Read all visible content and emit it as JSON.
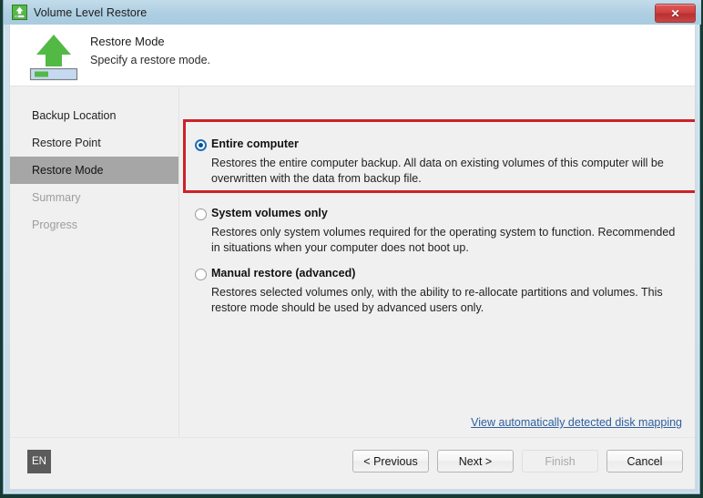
{
  "window": {
    "title": "Volume Level Restore",
    "icon": "restore-drive-icon",
    "close_label": "✕"
  },
  "header": {
    "title": "Restore Mode",
    "subtitle": "Specify a restore mode.",
    "icon": "green-up-arrow-drive-icon"
  },
  "sidebar": {
    "items": [
      {
        "label": "Backup Location",
        "state": "normal"
      },
      {
        "label": "Restore Point",
        "state": "normal"
      },
      {
        "label": "Restore Mode",
        "state": "active"
      },
      {
        "label": "Summary",
        "state": "disabled"
      },
      {
        "label": "Progress",
        "state": "disabled"
      }
    ]
  },
  "main": {
    "options": [
      {
        "label": "Entire computer",
        "description": "Restores the entire computer backup. All data on existing volumes of this computer will be overwritten with the data from backup file.",
        "selected": true,
        "highlighted": true
      },
      {
        "label": "System volumes only",
        "description": "Restores only system volumes required for the operating system to function. Recommended in situations when your computer does not boot up.",
        "selected": false,
        "highlighted": false
      },
      {
        "label": "Manual restore (advanced)",
        "description": "Restores selected volumes only, with the ability to re-allocate partitions and volumes. This restore mode should be used by advanced users only.",
        "selected": false,
        "highlighted": false
      }
    ],
    "disk_mapping_link": "View automatically detected disk mapping"
  },
  "footer": {
    "language": "EN",
    "buttons": [
      {
        "label": "< Previous",
        "enabled": true
      },
      {
        "label": "Next >",
        "enabled": true
      },
      {
        "label": "Finish",
        "enabled": false
      },
      {
        "label": "Cancel",
        "enabled": true
      }
    ]
  },
  "colors": {
    "accent_green": "#4caf3f",
    "highlight_red": "#cc2229",
    "link_blue": "#2f5f9e",
    "radio_blue": "#1b6fb5",
    "titlebar_blue": "#aecee2"
  }
}
